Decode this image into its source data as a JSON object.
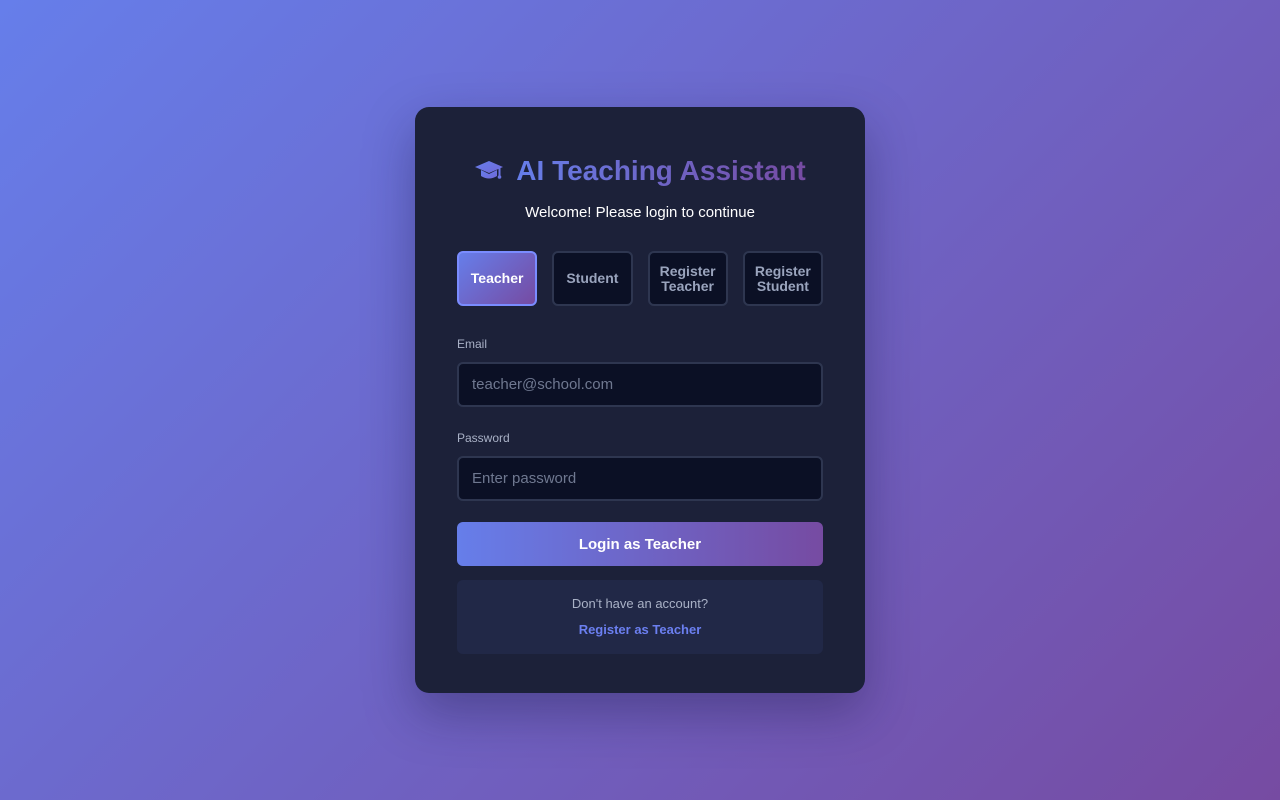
{
  "app": {
    "title": "AI Teaching Assistant",
    "subtitle": "Welcome! Please login to continue",
    "icon": "graduation-cap-icon"
  },
  "tabs": [
    {
      "label": "Teacher",
      "active": true
    },
    {
      "label": "Student",
      "active": false
    },
    {
      "label": "Register Teacher",
      "active": false
    },
    {
      "label": "Register Student",
      "active": false
    }
  ],
  "form": {
    "email_label": "Email",
    "email_placeholder": "teacher@school.com",
    "email_value": "",
    "password_label": "Password",
    "password_placeholder": "Enter password",
    "password_value": "",
    "submit_label": "Login as Teacher"
  },
  "register": {
    "prompt": "Don't have an account?",
    "link_label": "Register as Teacher"
  },
  "colors": {
    "gradient_start": "#667eea",
    "gradient_end": "#764ba2",
    "card_bg": "#1c2139",
    "input_bg": "#0b1025",
    "link": "#6b7ff0"
  }
}
